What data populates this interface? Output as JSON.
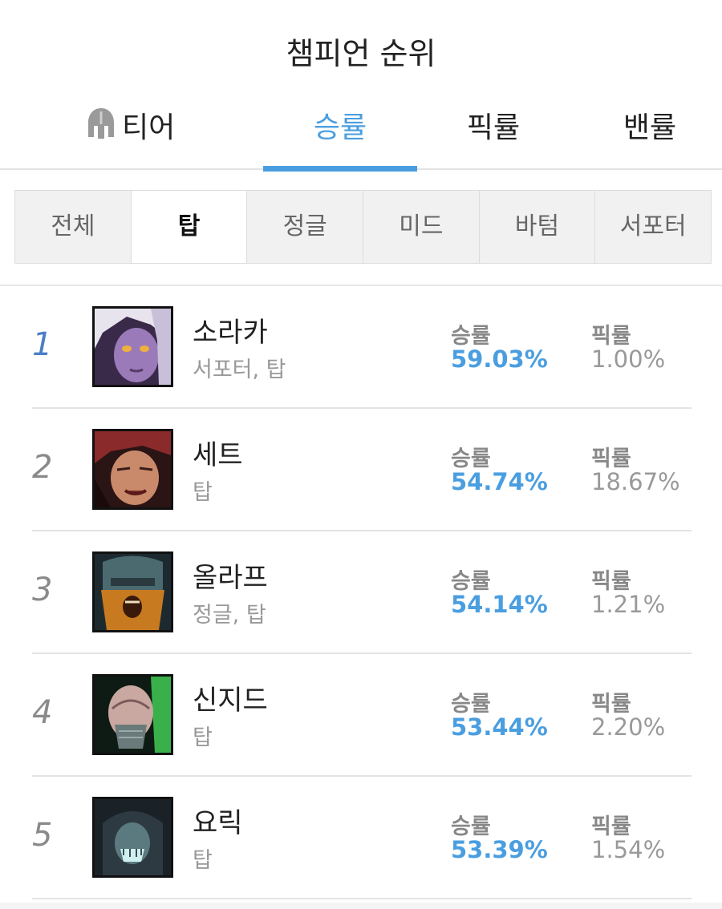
{
  "page": {
    "title": "챔피언 순위"
  },
  "main_tabs": [
    {
      "label": "티어",
      "icon": "helmet-icon",
      "active": false
    },
    {
      "label": "승률",
      "active": true
    },
    {
      "label": "픽률",
      "active": false
    },
    {
      "label": "밴률",
      "active": false
    }
  ],
  "position_tabs": [
    {
      "label": "전체",
      "active": false
    },
    {
      "label": "탑",
      "active": true
    },
    {
      "label": "정글",
      "active": false
    },
    {
      "label": "미드",
      "active": false
    },
    {
      "label": "바텀",
      "active": false
    },
    {
      "label": "서포터",
      "active": false
    }
  ],
  "stat_labels": {
    "win": "승률",
    "pick": "픽률"
  },
  "champions": [
    {
      "rank": "1",
      "name": "소라카",
      "positions": "서포터, 탑",
      "win_rate": "59.03%",
      "pick_rate": "1.00%"
    },
    {
      "rank": "2",
      "name": "세트",
      "positions": "탑",
      "win_rate": "54.74%",
      "pick_rate": "18.67%"
    },
    {
      "rank": "3",
      "name": "올라프",
      "positions": "정글, 탑",
      "win_rate": "54.14%",
      "pick_rate": "1.21%"
    },
    {
      "rank": "4",
      "name": "신지드",
      "positions": "탑",
      "win_rate": "53.44%",
      "pick_rate": "2.20%"
    },
    {
      "rank": "5",
      "name": "요릭",
      "positions": "탑",
      "win_rate": "53.39%",
      "pick_rate": "1.54%"
    }
  ],
  "colors": {
    "accent": "#4a9ee0",
    "rank_first": "#4a7fc8",
    "muted": "#999999"
  }
}
